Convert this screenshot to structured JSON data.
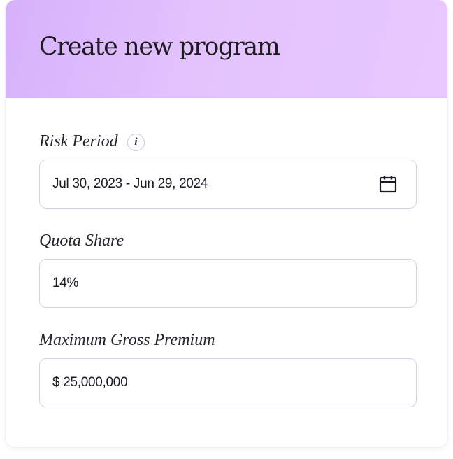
{
  "form": {
    "title": "Create new program",
    "fields": {
      "risk_period": {
        "label": "Risk Period",
        "info_icon": "info-icon",
        "info_glyph": "i",
        "value": "Jul 30, 2023 - Jun 29, 2024",
        "icon": "calendar-icon"
      },
      "quota_share": {
        "label": "Quota Share",
        "value": "14%"
      },
      "max_gross_premium": {
        "label": "Maximum Gross Premium",
        "value": "$ 25,000,000"
      }
    }
  },
  "colors": {
    "header_gradient_start": "#d6b1fb",
    "header_gradient_end": "#e8c8ff",
    "field_border": "#d8d1e6",
    "text": "#1d1a22"
  }
}
